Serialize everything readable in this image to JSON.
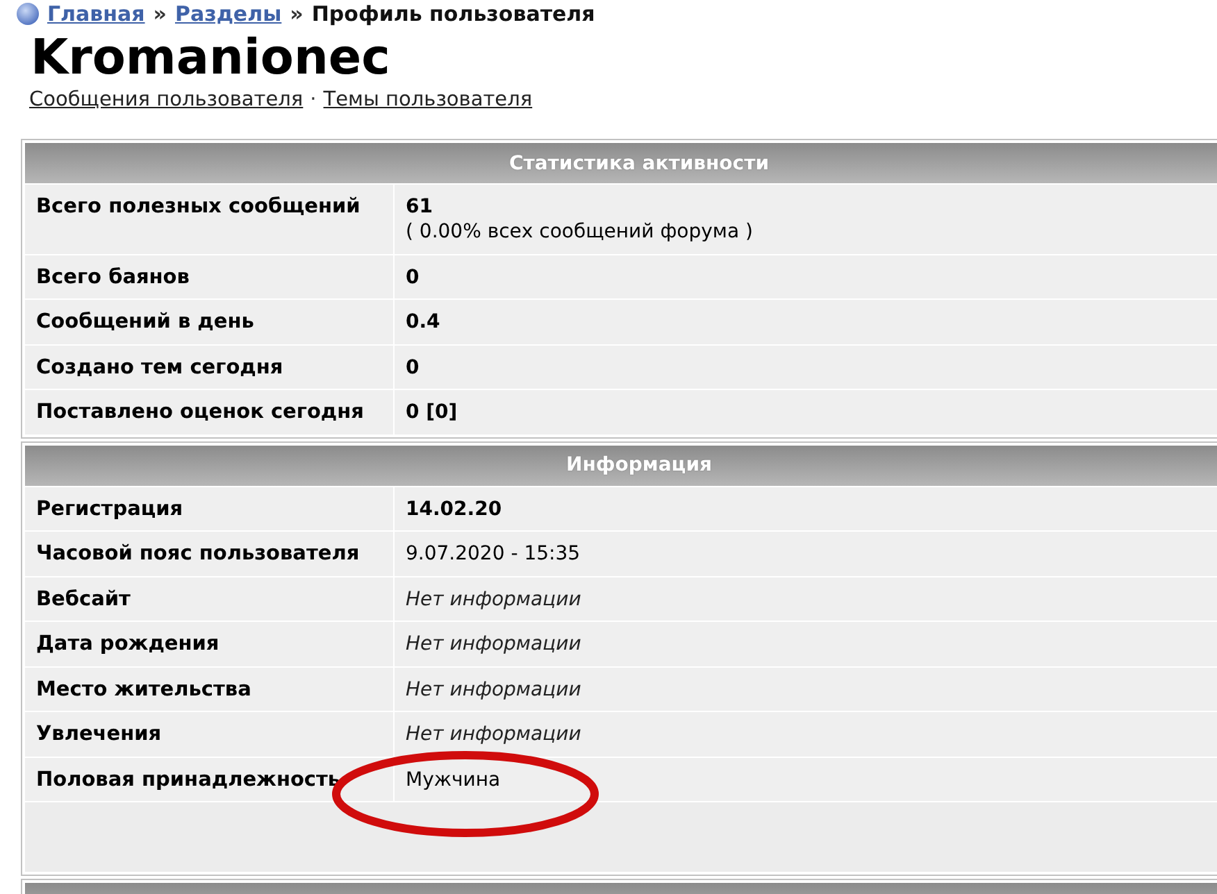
{
  "breadcrumb": [
    {
      "kind": "link",
      "text": "Главная"
    },
    {
      "kind": "separator",
      "text": "»"
    },
    {
      "kind": "link",
      "text": "Разделы"
    },
    {
      "kind": "separator",
      "text": "»"
    },
    {
      "kind": "current",
      "text": "Профиль пользователя"
    }
  ],
  "profile": {
    "username": "Kromanionec",
    "links": [
      {
        "kind": "link",
        "text": "Сообщения пользователя"
      },
      {
        "kind": "separator",
        "text": "·"
      },
      {
        "kind": "link",
        "text": "Темы пользователя"
      }
    ]
  },
  "sections": [
    {
      "title": "Статистика активности",
      "rows": [
        {
          "label": "Всего полезных сообщений",
          "value": "61",
          "kind": "strong",
          "note": "( 0.00% всех сообщений форума )"
        },
        {
          "label": "Всего баянов",
          "value": "0",
          "kind": "strong"
        },
        {
          "label": "Сообщений в день",
          "value": "0.4",
          "kind": "strong"
        },
        {
          "label": "Создано тем сегодня",
          "value": "0",
          "kind": "strong"
        },
        {
          "label": "Поставлено оценок сегодня",
          "value": "0 [0]",
          "kind": "strong"
        }
      ]
    },
    {
      "title": "Информация",
      "rows": [
        {
          "label": "Регистрация",
          "value": "14.02.20",
          "kind": "strong"
        },
        {
          "label": "Часовой пояс пользователя",
          "value": "9.07.2020 - 15:35",
          "kind": "plain"
        },
        {
          "label": "Вебсайт",
          "value": "Нет информации",
          "kind": "empty"
        },
        {
          "label": "Дата рождения",
          "value": "Нет информации",
          "kind": "empty"
        },
        {
          "label": "Место жительства",
          "value": "Нет информации",
          "kind": "empty"
        },
        {
          "label": "Увлечения",
          "value": "Нет информации",
          "kind": "empty"
        },
        {
          "label": "Половая принадлежность",
          "value": "Мужчина",
          "kind": "plain"
        }
      ]
    }
  ]
}
